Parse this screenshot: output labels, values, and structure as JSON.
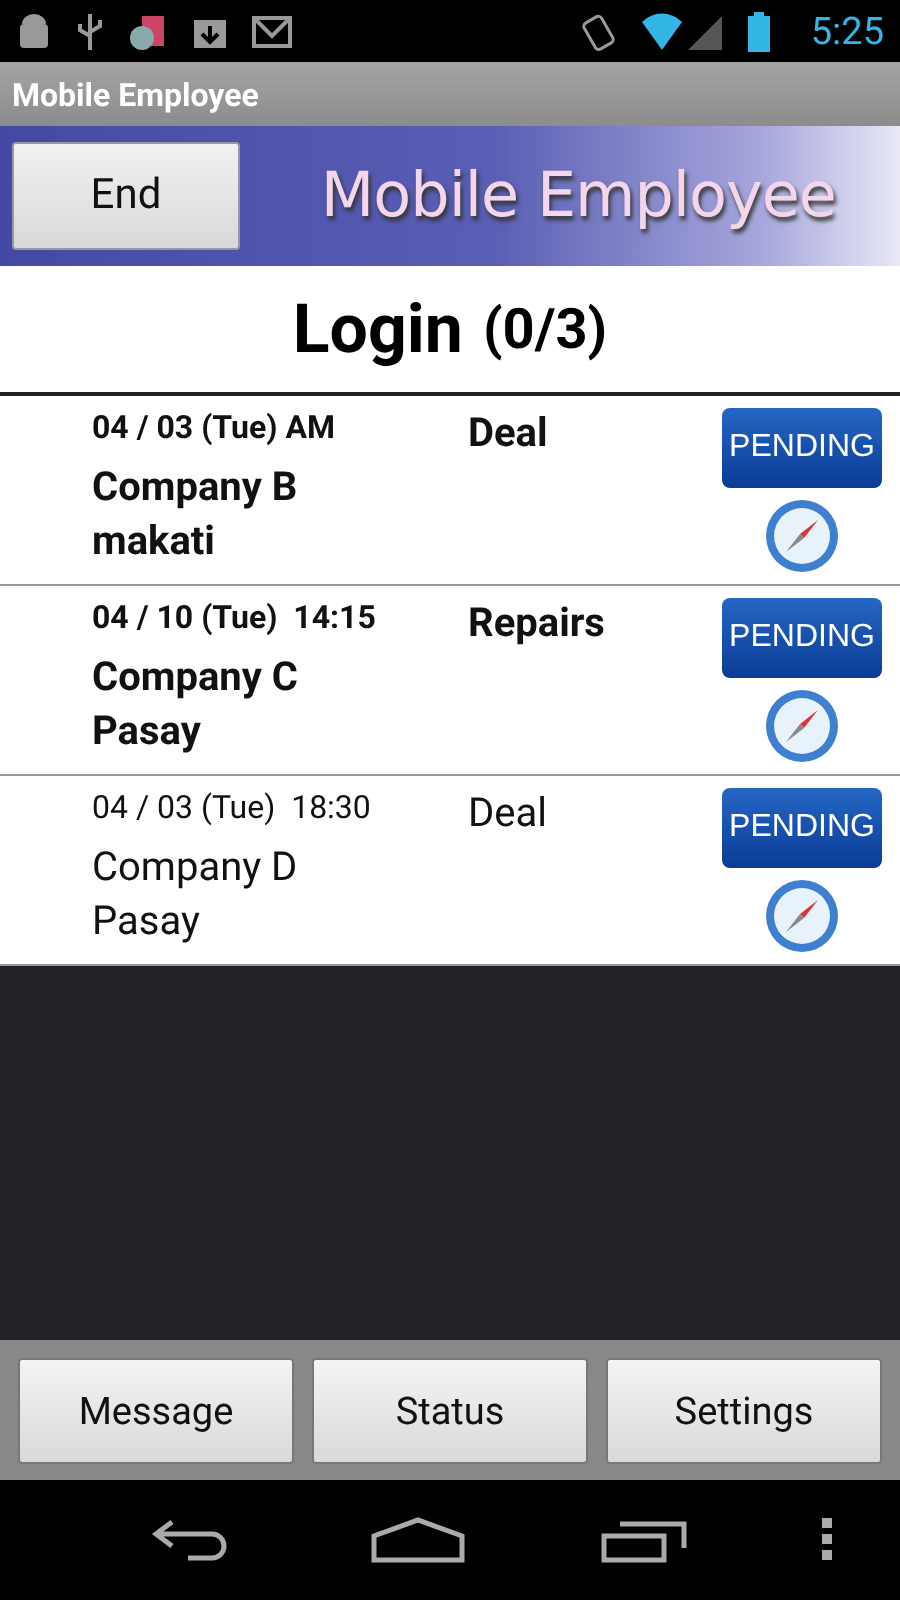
{
  "status_bar": {
    "time": "5:25"
  },
  "app_bar": {
    "title": "Mobile Employee"
  },
  "banner": {
    "end_button": "End",
    "logo_text": "Mobile Employee"
  },
  "heading": {
    "title": "Login",
    "count": "(0/3)"
  },
  "visits": [
    {
      "date": "04 / 03 (Tue) AM",
      "type": "Deal",
      "company": "Company B",
      "place": "makati",
      "status": "PENDING",
      "unread": true
    },
    {
      "date": "04 / 10 (Tue)  14:15",
      "type": "Repairs",
      "company": "Company C",
      "place": "Pasay",
      "status": "PENDING",
      "unread": true
    },
    {
      "date": "04 / 03 (Tue)  18:30",
      "type": "Deal",
      "company": "Company D",
      "place": "Pasay",
      "status": "PENDING",
      "unread": false
    }
  ],
  "bottom_buttons": [
    "Message",
    "Status",
    "Settings"
  ]
}
